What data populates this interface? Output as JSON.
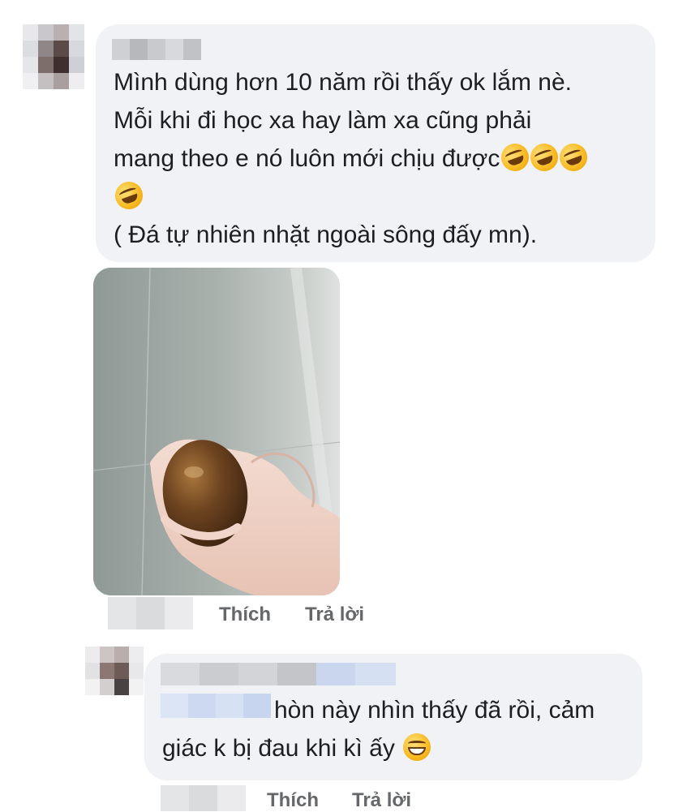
{
  "comments": [
    {
      "author_name": "",
      "text_lines": [
        "Mình dùng hơn 10 năm rồi thấy ok lắm nè.",
        "Mỗi khi đi học xa hay làm xa cũng phải",
        "mang theo e nó luôn mới chịu được"
      ],
      "text_tail": "( Đá tự nhiên nhặt ngoài sông đấy mn).",
      "emoji": "rolling-on-floor-laughing-icon",
      "actions": {
        "like": "Thích",
        "reply": "Trả lời"
      }
    },
    {
      "author_name": "",
      "text_first": "hòn này nhìn thấy đã rồi, cảm",
      "text_second": "giác k bị đau khi kì ấy",
      "emoji": "grinning-face-icon",
      "actions": {
        "like": "Thích",
        "reply": "Trả lời"
      }
    }
  ],
  "colors": {
    "bubble_bg": "#f0f2f5",
    "action_text": "#65676b",
    "text": "#1c1e21"
  }
}
